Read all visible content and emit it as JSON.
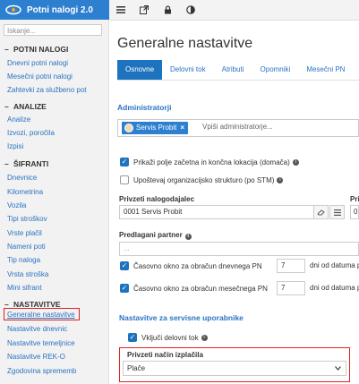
{
  "app": {
    "title": "Potni nalogi 2.0"
  },
  "toolbar": {
    "icons": [
      "menu-icon",
      "external-link-icon",
      "lock-icon",
      "contrast-icon"
    ]
  },
  "sidebar": {
    "search_placeholder": "Iskanje...",
    "sections": [
      {
        "label": "POTNI NALOGI",
        "items": [
          "Dnevni potni nalogi",
          "Mesečni potni nalogi",
          "Zahtevki za službeno pot"
        ]
      },
      {
        "label": "ANALIZE",
        "items": [
          "Analize",
          "Izvozi, poročila",
          "Izpisi"
        ]
      },
      {
        "label": "ŠIFRANTI",
        "items": [
          "Dnevnice",
          "Kilometrina",
          "Vozila",
          "Tipi stroškov",
          "Vrste plačil",
          "Nameni poti",
          "Tip naloga",
          "Vrsta stroška",
          "Mini sifrant"
        ]
      },
      {
        "label": "NASTAVITVE",
        "items": [
          "Generalne nastavitve",
          "Nastavitve dnevnic",
          "Nastavitve temeljnice",
          "Nastavitve REK-O",
          "Zgodovina sprememb"
        ]
      }
    ]
  },
  "main": {
    "title": "Generalne nastavitve",
    "tabs": [
      "Osnovne",
      "Delovni tok",
      "Atributi",
      "Opomniki",
      "Mesečni PN"
    ],
    "admins_heading": "Administratorji",
    "admin_tag": "Servis Probit",
    "admin_placeholder": "Vpiši administratorje...",
    "opt1": "Prikaži polje začetna in končna lokacija (domača)",
    "opt2": "Upoštevaj organizacijsko strukturo (po STM)",
    "default_payer_label": "Privzeti nalogodajalec",
    "default_payer_value": "0001 Servis Probit",
    "col2_label": "Pri",
    "col2_value": "0",
    "suggested_partner_label": "Predlagani partner",
    "suggested_partner_value": "...",
    "daily_window_label": "Časovno okno za obračun dnevnega PN",
    "daily_window_value": "7",
    "daily_window_suffix": "dni od datuma p",
    "monthly_window_label": "Časovno okno za obračun mesečnega PN",
    "monthly_window_value": "7",
    "monthly_window_suffix": "dni od datuma p",
    "service_heading": "Nastavitve za servisne uporabnike",
    "workflow_label": "Vključi delovni tok",
    "payout_label": "Privzeti način izplačila",
    "payout_value": "Plače"
  }
}
